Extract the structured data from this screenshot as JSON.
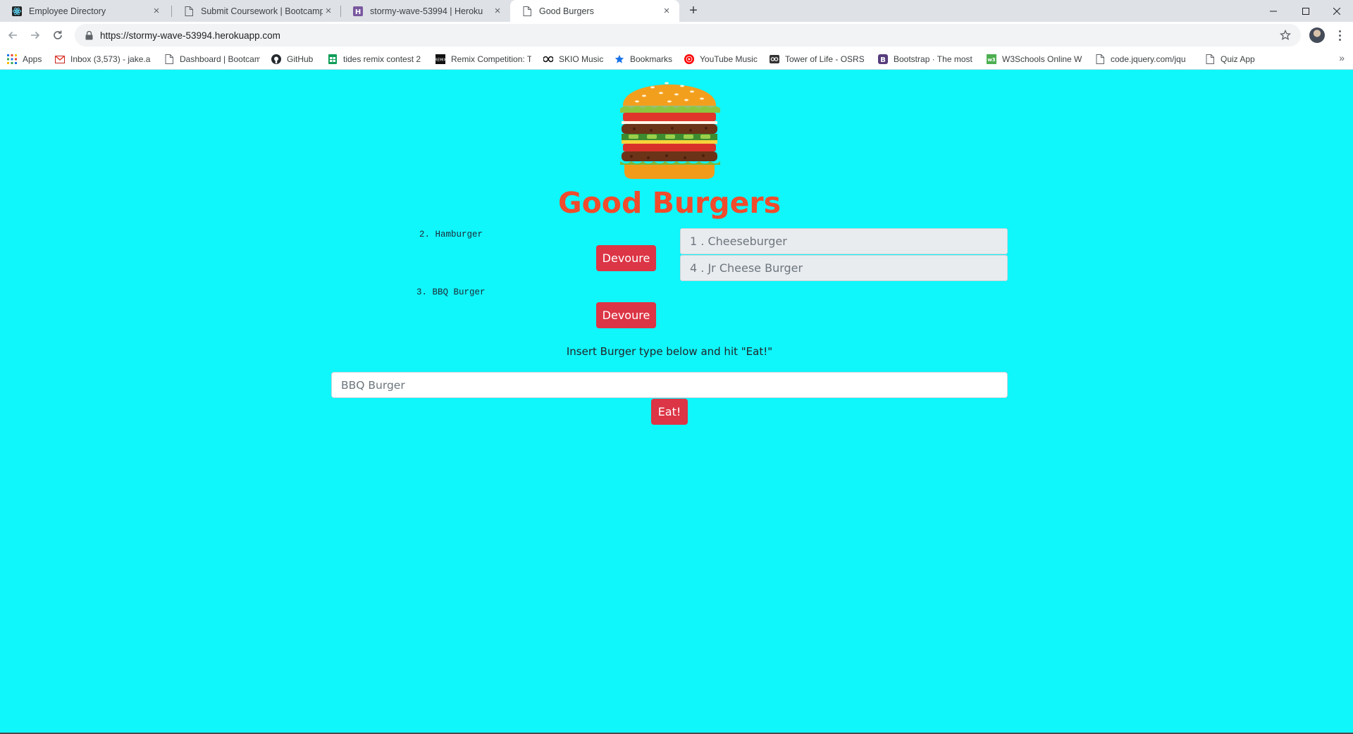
{
  "browser": {
    "tabs": [
      {
        "title": "Employee Directory",
        "icon": "react-icon"
      },
      {
        "title": "Submit Coursework | Bootcamp S",
        "icon": "page-icon"
      },
      {
        "title": "stormy-wave-53994 | Heroku",
        "icon": "heroku-icon"
      },
      {
        "title": "Good Burgers",
        "icon": "page-icon"
      }
    ],
    "new_tab": "+",
    "url": "https://stormy-wave-53994.herokuapp.com",
    "bookmarks": [
      {
        "label": "Apps",
        "icon": "apps-grid-icon"
      },
      {
        "label": "Inbox (3,573) - jake.a",
        "icon": "gmail-icon"
      },
      {
        "label": "Dashboard | Bootcam",
        "icon": "page-icon"
      },
      {
        "label": "GitHub",
        "icon": "github-icon"
      },
      {
        "label": "tides remix contest 2",
        "icon": "sheets-icon"
      },
      {
        "label": "Remix Competition: T",
        "icon": "remix-icon"
      },
      {
        "label": "SKIO Music",
        "icon": "skio-icon"
      },
      {
        "label": "Bookmarks",
        "icon": "star-icon"
      },
      {
        "label": "YouTube Music",
        "icon": "youtube-music-icon"
      },
      {
        "label": "Tower of Life - OSRS",
        "icon": "osrs-icon"
      },
      {
        "label": "Bootstrap · The most",
        "icon": "bootstrap-icon"
      },
      {
        "label": "W3Schools Online W",
        "icon": "w3schools-icon"
      },
      {
        "label": "code.jquery.com/jqu",
        "icon": "page-icon"
      },
      {
        "label": "Quiz App",
        "icon": "page-icon"
      }
    ],
    "more": "»"
  },
  "page": {
    "title": "Good Burgers",
    "uneaten": [
      {
        "label": "2. Hamburger",
        "button": "Devoure"
      },
      {
        "label": "3. BBQ Burger",
        "button": "Devoure"
      }
    ],
    "devoured": [
      "1 . Cheeseburger",
      "4 . Jr Cheese Burger"
    ],
    "instructions": "Insert Burger type below and hit \"Eat!\"",
    "input_placeholder": "BBQ Burger",
    "eat_button": "Eat!"
  },
  "colors": {
    "background": "#0ff6fb",
    "title": "#ef4b2c",
    "button": "#dc3545"
  }
}
